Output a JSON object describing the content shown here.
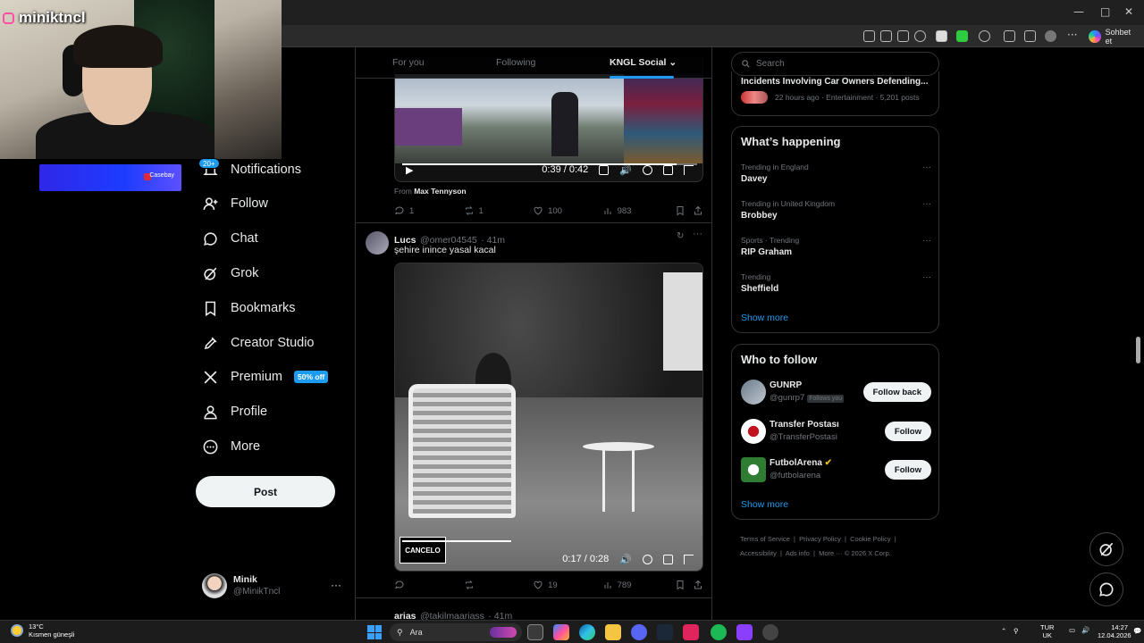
{
  "streamer": {
    "name": "miniktncl",
    "sponsor_label": "Casebay"
  },
  "browser": {
    "chat_button": "Sohbet et"
  },
  "nav": {
    "notifications_badge": "20+",
    "items": [
      {
        "label": "Notifications",
        "icon": "bell-icon"
      },
      {
        "label": "Follow",
        "icon": "follow-icon"
      },
      {
        "label": "Chat",
        "icon": "chat-icon"
      },
      {
        "label": "Grok",
        "icon": "grok-icon"
      },
      {
        "label": "Bookmarks",
        "icon": "bookmark-icon"
      },
      {
        "label": "Creator Studio",
        "icon": "rocket-icon"
      },
      {
        "label": "Premium",
        "icon": "x-logo-icon"
      },
      {
        "label": "Profile",
        "icon": "profile-icon"
      },
      {
        "label": "More",
        "icon": "more-circle-icon"
      }
    ],
    "premium_badge": "50% off",
    "post_button": "Post",
    "account": {
      "name": "Minik",
      "handle": "@MinikTncl"
    }
  },
  "tabs": {
    "for_you": "For you",
    "following": "Following",
    "community": "KNGL Social"
  },
  "tweet1": {
    "video_time": "0:39 / 0:42",
    "from_prefix": "From",
    "from_name": "Max Tennyson",
    "replies": "1",
    "reposts": "1",
    "likes": "100",
    "views": "983",
    "progress": 0.93
  },
  "tweet2": {
    "name": "Lucs",
    "handle": "@omer04545",
    "time": "· 41m",
    "text": "şehire inince yasal kacal",
    "video_time": "0:17 / 0:28",
    "video_badge": "CANCELO",
    "replies": "",
    "reposts": "",
    "likes": "19",
    "views": "789",
    "progress": 0.61
  },
  "tweet3": {
    "name": "arias",
    "handle": "@takilmaariass",
    "time": "· 41m"
  },
  "search": {
    "placeholder": "Search"
  },
  "top_trend": {
    "title": "Incidents Involving Car Owners Defending...",
    "meta": "22 hours ago · Entertainment · 5,201 posts"
  },
  "happening": {
    "title": "What’s happening",
    "trends": [
      {
        "meta": "Trending in England",
        "name": "Davey"
      },
      {
        "meta": "Trending in United Kingdom",
        "name": "Brobbey"
      },
      {
        "meta": "Sports · Trending",
        "name": "RIP Graham"
      },
      {
        "meta": "Trending",
        "name": "Sheffield"
      }
    ],
    "show_more": "Show more"
  },
  "who_to_follow": {
    "title": "Who to follow",
    "accounts": [
      {
        "name": "GUNRP",
        "handle": "@gunrp7",
        "follows_you": "Follows you",
        "button": "Follow back"
      },
      {
        "name": "Transfer Postası",
        "handle": "@TransferPostasi",
        "button": "Follow"
      },
      {
        "name": "FutbolArena",
        "handle": "@futbolarena",
        "button": "Follow"
      }
    ],
    "show_more": "Show more"
  },
  "footer": {
    "links": [
      "Terms of Service",
      "Privacy Policy",
      "Cookie Policy",
      "Accessibility",
      "Ads info",
      "More ···"
    ],
    "copyright": "© 2026 X Corp."
  },
  "taskbar": {
    "temp": "13°C",
    "weather": "Kısmen güneşli",
    "search": "Ara",
    "lang_top": "TUR",
    "lang_bottom": "UK",
    "time": "14:27",
    "date": "12.04.2026"
  },
  "colors": {
    "accent": "#1d9bf0",
    "background": "#000000",
    "border": "#2f3336"
  }
}
